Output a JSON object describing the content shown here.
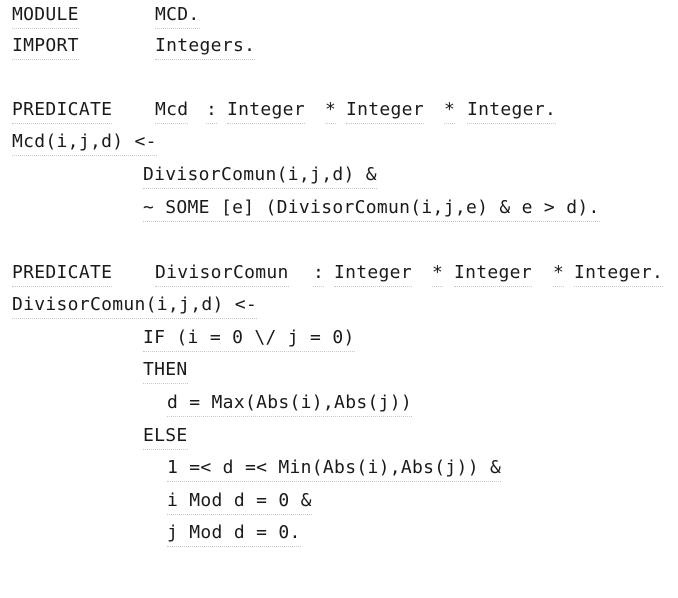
{
  "code": {
    "l1": {
      "keyword": "MODULE",
      "value": "MCD."
    },
    "l2": {
      "keyword": "IMPORT",
      "value": "Integers."
    },
    "l3": {
      "keyword": "PREDICATE",
      "name": "Mcd",
      "sep": ":",
      "t1": "Integer",
      "star1": "*",
      "t2": "Integer",
      "star2": "*",
      "t3": "Integer."
    },
    "l4": {
      "text": "Mcd(i,j,d) <-"
    },
    "l5": {
      "text": "DivisorComun(i,j,d) &"
    },
    "l6": {
      "text": "~ SOME [e] (DivisorComun(i,j,e) & e > d)."
    },
    "l7": {
      "keyword": "PREDICATE",
      "name": "DivisorComun",
      "sep": ":",
      "t1": "Integer",
      "star1": "*",
      "t2": "Integer",
      "star2": "*",
      "t3": "Integer."
    },
    "l8": {
      "text": "DivisorComun(i,j,d) <-"
    },
    "l9": {
      "text": "IF (i = 0 \\/ j = 0)"
    },
    "l10": {
      "text": "THEN"
    },
    "l11": {
      "text": "d = Max(Abs(i),Abs(j))"
    },
    "l12": {
      "text": "ELSE"
    },
    "l13": {
      "text": "1 =< d =< Min(Abs(i),Abs(j)) &"
    },
    "l14": {
      "text": "i Mod d = 0 &"
    },
    "l15": {
      "text": "j Mod d = 0."
    }
  }
}
